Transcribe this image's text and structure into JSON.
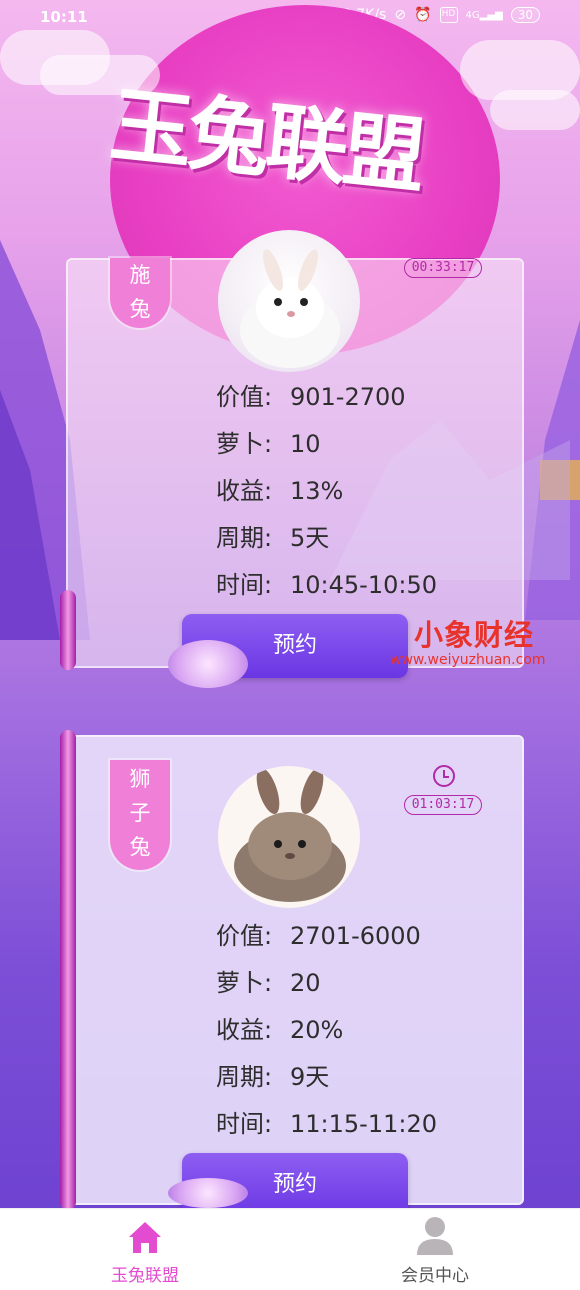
{
  "status_bar": {
    "time": "10:11",
    "network_speed": "3.7K/s",
    "hd_label": "HD",
    "signal_label": "4G",
    "battery": "30"
  },
  "app_title": "玉兔联盟",
  "cards": [
    {
      "badge": "施\n兔",
      "timer": "00:33:17",
      "value_label": "价值:",
      "value": "901-2700",
      "carrot_label": "萝卜:",
      "carrot": "10",
      "yield_label": "收益:",
      "yield": "13%",
      "period_label": "周期:",
      "period": "5天",
      "time_label": "时间:",
      "time": "10:45-10:50",
      "button": "预约"
    },
    {
      "badge": "狮\n子\n兔",
      "timer": "01:03:17",
      "value_label": "价值:",
      "value": "2701-6000",
      "carrot_label": "萝卜:",
      "carrot": "20",
      "yield_label": "收益:",
      "yield": "20%",
      "period_label": "周期:",
      "period": "9天",
      "time_label": "时间:",
      "time": "11:15-11:20",
      "button": "预约"
    }
  ],
  "watermark": {
    "brand": "小象财经",
    "url": "www.weiyuzhuan.com"
  },
  "bottom_nav": {
    "home": "玉兔联盟",
    "member": "会员中心"
  },
  "colors": {
    "accent": "#e34bd0",
    "button": "#6a36e3",
    "timer": "#b22aa7"
  }
}
